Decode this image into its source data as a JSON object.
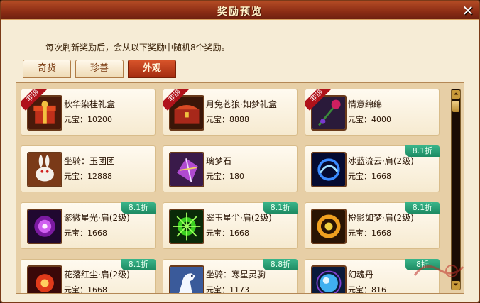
{
  "window": {
    "title": "奖励预览",
    "close_glyph": "✕"
  },
  "info_text": "每次刷新奖励后，会从以下奖励中随机8个奖励。",
  "tabs": [
    {
      "label": "奇货",
      "active": false
    },
    {
      "label": "珍善",
      "active": false
    },
    {
      "label": "外观",
      "active": true
    }
  ],
  "rare_label": "非绑",
  "items": [
    {
      "name": "秋华染桂礼盒",
      "price": "元宝：10200",
      "discount": "",
      "rare": true,
      "icon": "gift-box-icon"
    },
    {
      "name": "月兔苍狼·如梦礼盒",
      "price": "元宝：8888",
      "discount": "",
      "rare": true,
      "icon": "treasure-chest-icon"
    },
    {
      "name": "情意绵绵",
      "price": "元宝：4000",
      "discount": "",
      "rare": true,
      "icon": "rose-icon"
    },
    {
      "name": "坐骑：玉团团",
      "price": "元宝：12888",
      "discount": "",
      "rare": false,
      "icon": "rabbit-mount-icon"
    },
    {
      "name": "璃梦石",
      "price": "元宝：180",
      "discount": "",
      "rare": false,
      "icon": "crystal-stone-icon"
    },
    {
      "name": "冰蓝流云·肩(2级)",
      "price": "元宝：1668",
      "discount": "8.1折",
      "rare": false,
      "icon": "blue-swirl-icon"
    },
    {
      "name": "紫微星光·肩(2级)",
      "price": "元宝：1668",
      "discount": "8.1折",
      "rare": false,
      "icon": "purple-orb-icon"
    },
    {
      "name": "翠玉星尘·肩(2级)",
      "price": "元宝：1668",
      "discount": "8.1折",
      "rare": false,
      "icon": "green-burst-icon"
    },
    {
      "name": "橙影如梦·肩(2级)",
      "price": "元宝：1668",
      "discount": "8.1折",
      "rare": false,
      "icon": "orange-ring-icon"
    },
    {
      "name": "花落红尘·肩(2级)",
      "price": "元宝：1668",
      "discount": "8.1折",
      "rare": false,
      "icon": "red-burst-icon"
    },
    {
      "name": "坐骑：寒星灵驹",
      "price": "元宝：1173",
      "discount": "8.8折",
      "rare": false,
      "icon": "white-horse-icon"
    },
    {
      "name": "幻魂丹",
      "price": "元宝：816",
      "discount": "8折",
      "rare": false,
      "icon": "soul-pill-icon"
    }
  ],
  "scroll": {
    "up_glyph": "⏶",
    "down_glyph": "⏷",
    "position": 0.0
  }
}
